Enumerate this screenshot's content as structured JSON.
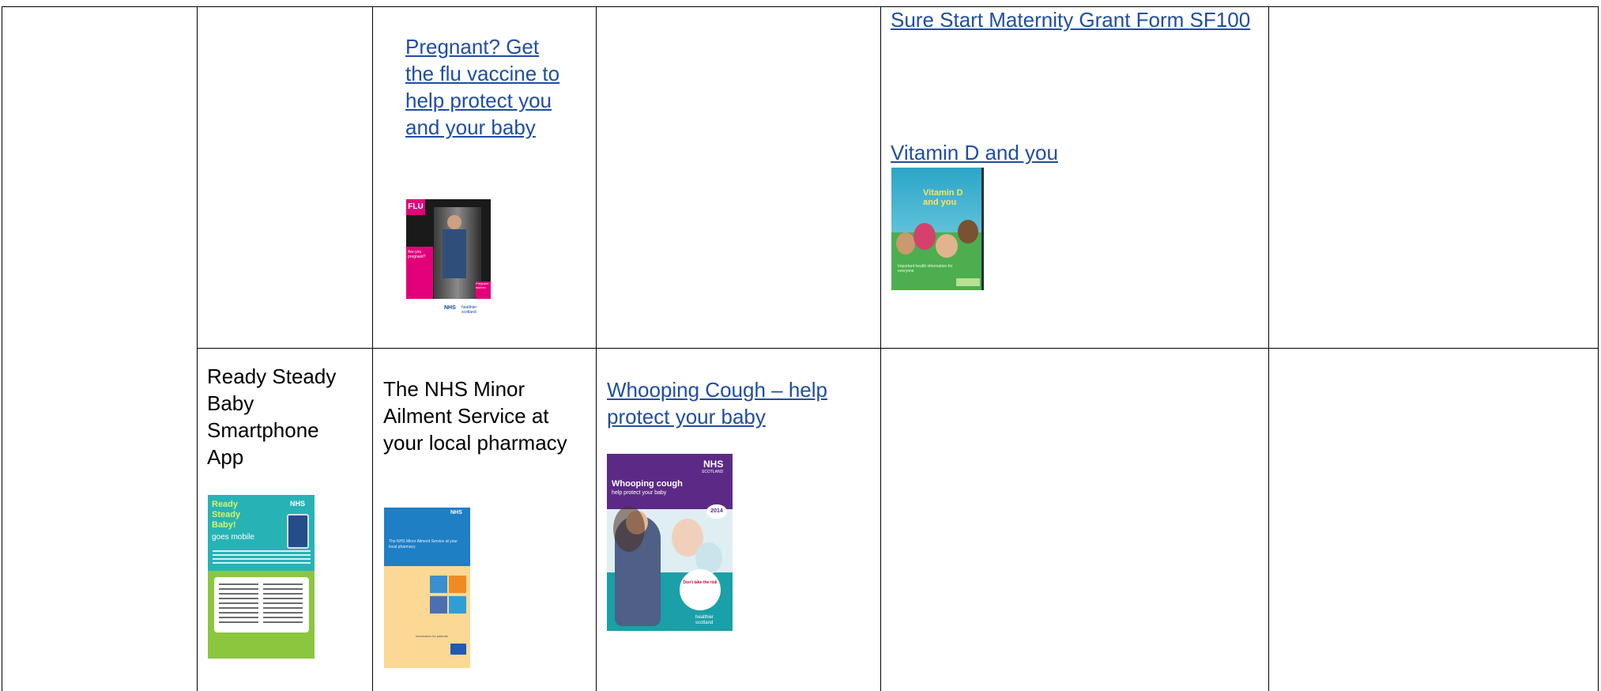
{
  "cells": {
    "flu_link": "Pregnant? Get the flu vaccine to help protect you and your baby",
    "grant_link": "Sure Start Maternity Grant Form SF100",
    "vitd_link": "Vitamin D and you",
    "rsb_text": "Ready Steady Baby Smartphone App",
    "minor_text": "The NHS Minor Ailment Service at your local pharmacy",
    "whoop_link": "Whooping Cough – help protect your baby"
  },
  "leaflets": {
    "flu": {
      "tag": "FLU",
      "sub": "Are you pregnant?",
      "badge": "Pregnant women",
      "logo1": "NHS",
      "logo2": "healthier scotland"
    },
    "vitd": {
      "title": "Vitamin D and you",
      "sub": "Important health information for everyone"
    },
    "rsb": {
      "title": "Ready Steady Baby!",
      "sub": "goes mobile",
      "logo": "NHS"
    },
    "minor": {
      "title": "The NHS Minor Ailment Service at your local pharmacy",
      "foot": "Information for patients",
      "logo": "NHS"
    },
    "whoop": {
      "logo": "NHS",
      "logo_sub": "SCOTLAND",
      "title": "Whooping cough",
      "sub": "help protect your baby",
      "year": "2014",
      "circle": "Don't take the risk",
      "hs": "healthier scotland"
    }
  },
  "colors": {
    "link": "#1f4ea3",
    "border": "#000000"
  }
}
